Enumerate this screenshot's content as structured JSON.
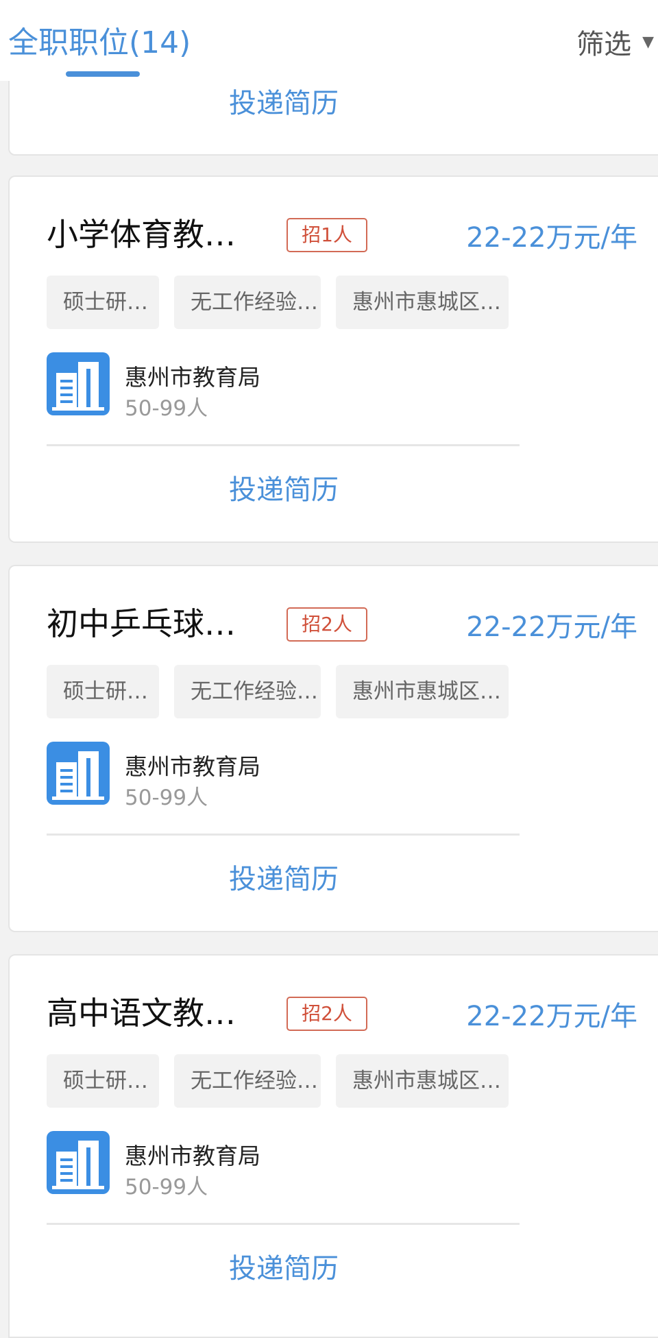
{
  "header": {
    "tab_label": "全职职位(14)",
    "filter_label": "筛选",
    "filter_icon": "caret-down-icon"
  },
  "top_card": {
    "apply_label": "投递简历"
  },
  "jobs": [
    {
      "title": "小学体育教…",
      "openings": "招1人",
      "salary": "22-22万元/年",
      "tags": [
        "硕士研…",
        "无工作经验…",
        "惠州市惠城区…"
      ],
      "company": "惠州市教育局",
      "company_size": "50-99人",
      "apply_label": "投递简历"
    },
    {
      "title": "初中乒乓球…",
      "openings": "招2人",
      "salary": "22-22万元/年",
      "tags": [
        "硕士研…",
        "无工作经验…",
        "惠州市惠城区…"
      ],
      "company": "惠州市教育局",
      "company_size": "50-99人",
      "apply_label": "投递简历"
    },
    {
      "title": "高中语文教…",
      "openings": "招2人",
      "salary": "22-22万元/年",
      "tags": [
        "硕士研…",
        "无工作经验…",
        "惠州市惠城区…"
      ],
      "company": "惠州市教育局",
      "company_size": "50-99人",
      "apply_label": "投递简历"
    }
  ],
  "colors": {
    "accent": "#4a90d9",
    "badge": "#d0503a",
    "logo": "#3b8ee3"
  }
}
